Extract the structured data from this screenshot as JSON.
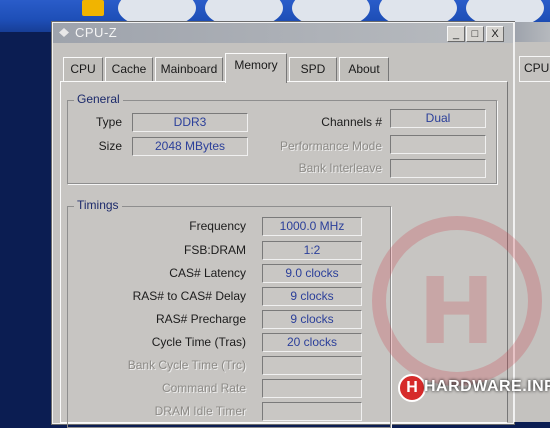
{
  "window": {
    "title": "CPU-Z",
    "min_label": "_",
    "max_label": "□",
    "close_label": "X"
  },
  "tabs": [
    {
      "label": "CPU"
    },
    {
      "label": "Cache"
    },
    {
      "label": "Mainboard"
    },
    {
      "label": "Memory",
      "active": true
    },
    {
      "label": "SPD"
    },
    {
      "label": "About"
    }
  ],
  "general": {
    "legend": "General",
    "type_label": "Type",
    "type_value": "DDR3",
    "size_label": "Size",
    "size_value": "2048 MBytes",
    "channels_label": "Channels #",
    "channels_value": "Dual",
    "perf_mode_label": "Performance Mode",
    "perf_mode_value": "",
    "bank_interleave_label": "Bank Interleave",
    "bank_interleave_value": ""
  },
  "timings": {
    "legend": "Timings",
    "rows": [
      {
        "label": "Frequency",
        "value": "1000.0 MHz",
        "disabled": false
      },
      {
        "label": "FSB:DRAM",
        "value": "1:2",
        "disabled": false
      },
      {
        "label": "CAS# Latency",
        "value": "9.0 clocks",
        "disabled": false
      },
      {
        "label": "RAS# to CAS# Delay",
        "value": "9 clocks",
        "disabled": false
      },
      {
        "label": "RAS# Precharge",
        "value": "9 clocks",
        "disabled": false
      },
      {
        "label": "Cycle Time (Tras)",
        "value": "20 clocks",
        "disabled": false
      },
      {
        "label": "Bank Cycle Time (Trc)",
        "value": "",
        "disabled": true
      },
      {
        "label": "Command Rate",
        "value": "",
        "disabled": true
      },
      {
        "label": "DRAM Idle Timer",
        "value": "",
        "disabled": true
      }
    ]
  },
  "second_window": {
    "tab_label": "CPU"
  },
  "watermark": {
    "brand": "HARDWARE.INFO",
    "badge": "H"
  },
  "colors": {
    "value_text": "#2b3f9a",
    "legend_text": "#1c2a6b",
    "watermark": "#d62b2b"
  }
}
